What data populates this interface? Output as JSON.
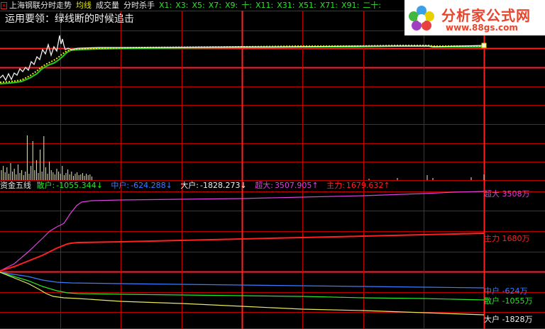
{
  "header": {
    "close_icon": "close-box-icon",
    "stock_label": "上海钢联分时走势",
    "avg_label": "均线",
    "volume_label": "成交量",
    "killer_label": "分时杀手",
    "x_labels": [
      "X1:",
      "X3:",
      "X5:",
      "X7:",
      "X9:",
      "十:",
      "X11:",
      "X31:",
      "X51:",
      "X71:",
      "X91:",
      "二十:"
    ],
    "colors": {
      "stock": "#e6e6e6",
      "avg": "#e8e800",
      "volume": "#e6e6e6",
      "killer": "#e6e6e6",
      "x": "#28e628"
    }
  },
  "tip": "运用要领：绿线断的时候追击",
  "logo": {
    "name": "分析家公式网",
    "url": "www.88gs.com",
    "icon": "flower-logo-icon"
  },
  "indicator": {
    "title": "资金五线",
    "items": [
      {
        "label": "散户:",
        "value": "-1055.344",
        "arrow": "↓",
        "color": "#28e628"
      },
      {
        "label": "中户:",
        "value": "-624.288",
        "arrow": "↓",
        "color": "#3a7cff"
      },
      {
        "label": "大户:",
        "value": "-1828.273",
        "arrow": "↓",
        "color": "#f0f0f0"
      },
      {
        "label": "超大:",
        "value": "3507.905",
        "arrow": "↑",
        "color": "#e040e0"
      },
      {
        "label": "主力:",
        "value": "1679.632",
        "arrow": "↑",
        "color": "#ff2020"
      }
    ],
    "right_labels": [
      {
        "text": "超大 3508万",
        "color": "#e040e0"
      },
      {
        "text": "主力 1680万",
        "color": "#ff2020"
      },
      {
        "text": "中户 -624万",
        "color": "#3a7cff"
      },
      {
        "text": "散户 -1055万",
        "color": "#28e628"
      },
      {
        "text": "大户 -1828万",
        "color": "#f0f0f0"
      }
    ]
  }
}
